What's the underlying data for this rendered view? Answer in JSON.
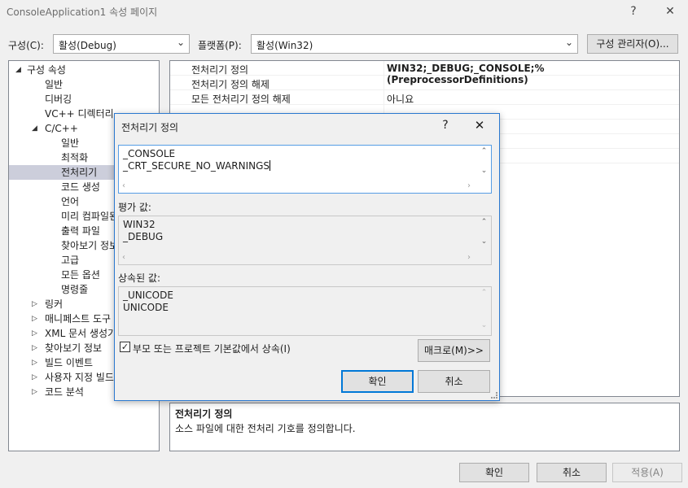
{
  "window": {
    "title": "ConsoleApplication1 속성 페이지",
    "help_label": "?",
    "close_label": "✕"
  },
  "config": {
    "config_label": "구성(C):",
    "config_value": "활성(Debug)",
    "platform_label": "플랫폼(P):",
    "platform_value": "활성(Win32)",
    "manager_button": "구성 관리자(O)..."
  },
  "tree": [
    {
      "label": "구성 속성",
      "expander": "◢",
      "level": 0
    },
    {
      "label": "일반",
      "expander": "",
      "level": 1
    },
    {
      "label": "디버깅",
      "expander": "",
      "level": 1
    },
    {
      "label": "VC++ 디렉터리",
      "expander": "",
      "level": 1
    },
    {
      "label": "C/C++",
      "expander": "◢",
      "level": 1
    },
    {
      "label": "일반",
      "expander": "",
      "level": 2
    },
    {
      "label": "최적화",
      "expander": "",
      "level": 2
    },
    {
      "label": "전처리기",
      "expander": "",
      "level": 2,
      "selected": true
    },
    {
      "label": "코드 생성",
      "expander": "",
      "level": 2
    },
    {
      "label": "언어",
      "expander": "",
      "level": 2
    },
    {
      "label": "미리 컴파일된 헤더",
      "expander": "",
      "level": 2
    },
    {
      "label": "출력 파일",
      "expander": "",
      "level": 2
    },
    {
      "label": "찾아보기 정보",
      "expander": "",
      "level": 2
    },
    {
      "label": "고급",
      "expander": "",
      "level": 2
    },
    {
      "label": "모든 옵션",
      "expander": "",
      "level": 2
    },
    {
      "label": "명령줄",
      "expander": "",
      "level": 2
    },
    {
      "label": "링커",
      "expander": "▷",
      "level": 1
    },
    {
      "label": "매니페스트 도구",
      "expander": "▷",
      "level": 1
    },
    {
      "label": "XML 문서 생성기",
      "expander": "▷",
      "level": 1
    },
    {
      "label": "찾아보기 정보",
      "expander": "▷",
      "level": 1
    },
    {
      "label": "빌드 이벤트",
      "expander": "▷",
      "level": 1
    },
    {
      "label": "사용자 지정 빌드 단계",
      "expander": "▷",
      "level": 1
    },
    {
      "label": "코드 분석",
      "expander": "▷",
      "level": 1
    }
  ],
  "grid": [
    {
      "key": "전처리기 정의",
      "value": "WIN32;_DEBUG;_CONSOLE;%(PreprocessorDefinitions)",
      "bold": true
    },
    {
      "key": "전처리기 정의 해제",
      "value": ""
    },
    {
      "key": "모든 전처리기 정의 해제",
      "value": "아니요"
    },
    {
      "key": "",
      "value": ""
    },
    {
      "key": "",
      "value": ""
    },
    {
      "key": "",
      "value": ""
    },
    {
      "key": "",
      "value": ""
    }
  ],
  "description": {
    "heading": "전처리기 정의",
    "text": "소스 파일에 대한 전처리 기호를 정의합니다."
  },
  "footer": {
    "ok": "확인",
    "cancel": "취소",
    "apply": "적용(A)"
  },
  "dialog": {
    "title": "전처리기 정의",
    "help_label": "?",
    "close_label": "✕",
    "edit_lines": [
      "_CONSOLE",
      "_CRT_SECURE_NO_WARNINGS"
    ],
    "evaluated_label": "평가 값:",
    "evaluated_lines": [
      "WIN32",
      "_DEBUG"
    ],
    "inherited_label": "상속된 값:",
    "inherited_lines": [
      "_UNICODE",
      "UNICODE"
    ],
    "inherit_checkbox_label": "부모 또는 프로젝트 기본값에서 상속(I)",
    "inherit_checked": true,
    "macro_button": "매크로(M)>>",
    "ok": "확인",
    "cancel": "취소"
  }
}
